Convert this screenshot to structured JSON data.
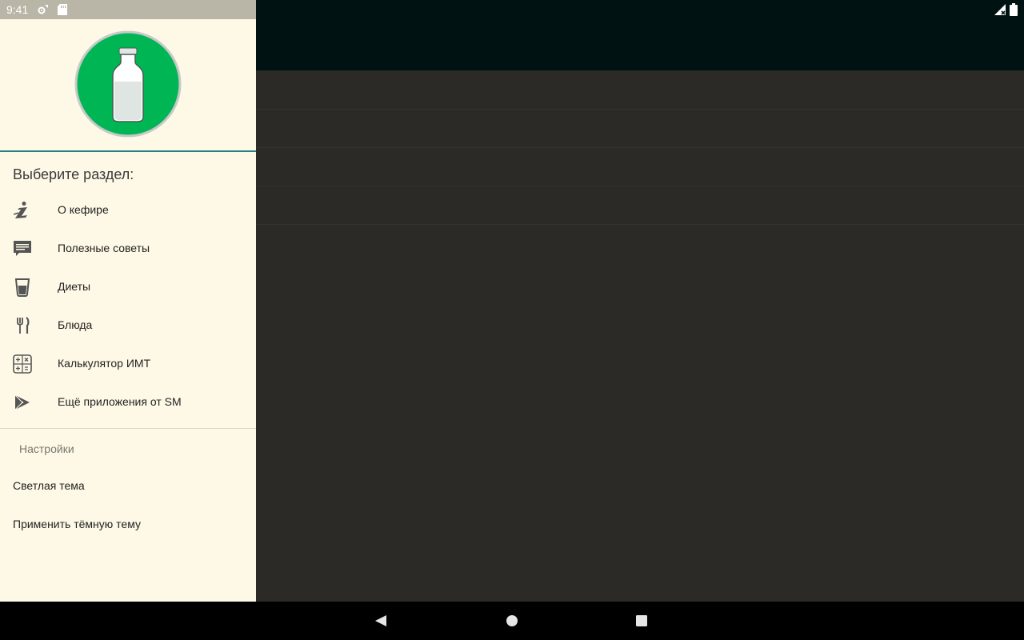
{
  "status_bar": {
    "time": "9:41",
    "left_icons": [
      "settings-sync-icon",
      "sd-card-icon"
    ],
    "right_icons": [
      "signal-icon",
      "battery-icon"
    ]
  },
  "colors": {
    "logo_green": "#00b654",
    "drawer_bg": "#fef9e6",
    "accent": "#2a7f7f"
  },
  "drawer": {
    "header_icon": "milk-bottle-icon",
    "section_title": "Выберите раздел:",
    "items": [
      {
        "label": "О кефире",
        "icon": "info-icon"
      },
      {
        "label": "Полезные советы",
        "icon": "comment-icon"
      },
      {
        "label": "Диеты",
        "icon": "glass-icon"
      },
      {
        "label": "Блюда",
        "icon": "fork-knife-icon"
      },
      {
        "label": "Калькулятор ИМТ",
        "icon": "calculator-icon"
      },
      {
        "label": "Ещё приложения от SM",
        "icon": "play-store-icon"
      }
    ],
    "settings": {
      "header": "Настройки",
      "items": [
        {
          "label": "Светлая тема"
        },
        {
          "label": "Применить тёмную тему"
        }
      ]
    }
  },
  "nav_bar": {
    "buttons": [
      "back-icon",
      "home-icon",
      "recents-icon"
    ]
  }
}
